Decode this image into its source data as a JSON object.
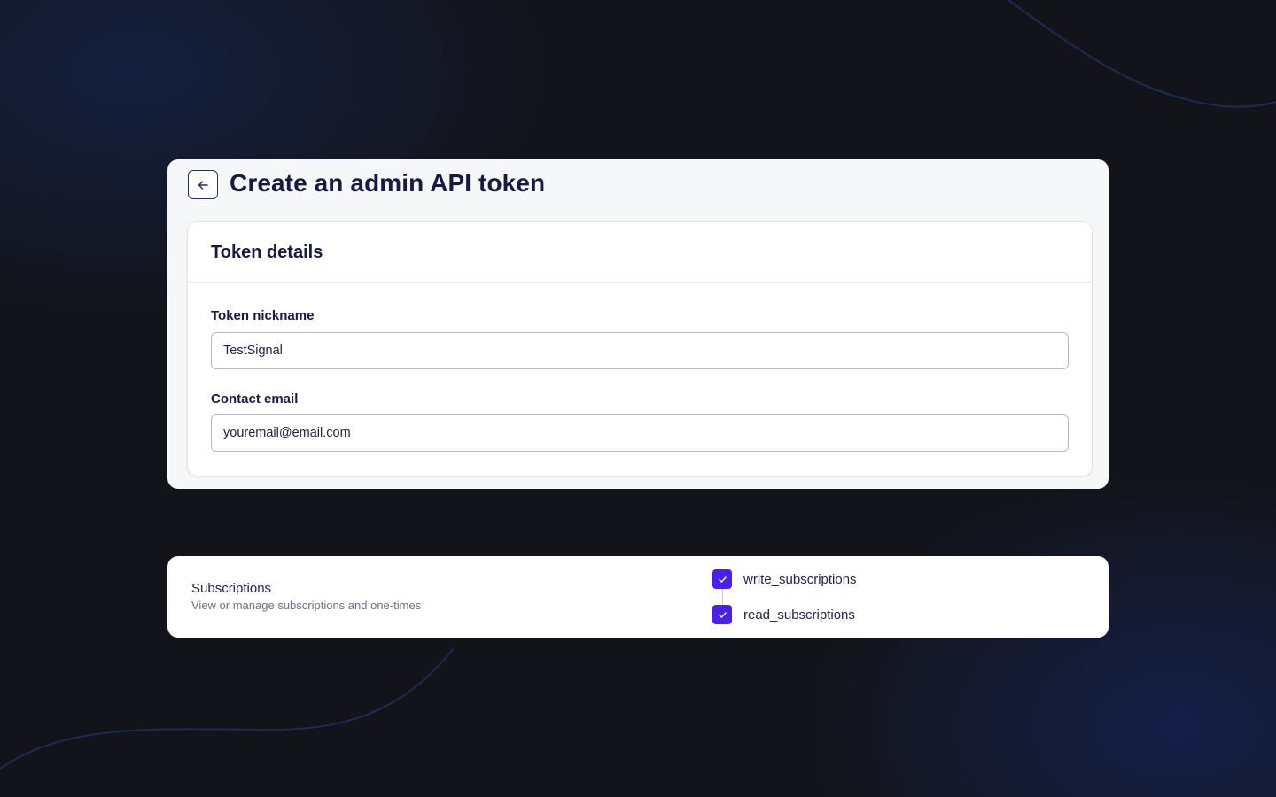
{
  "header": {
    "back_label": "Back",
    "title": "Create an admin API token"
  },
  "token_details": {
    "title": "Token details",
    "nickname_label": "Token nickname",
    "nickname_value": "TestSignal",
    "email_label": "Contact email",
    "email_value": "youremail@email.com"
  },
  "subscriptions": {
    "title": "Subscriptions",
    "description": "View or manage subscriptions and one-times",
    "permissions": [
      {
        "label": "write_subscriptions",
        "checked": true
      },
      {
        "label": "read_subscriptions",
        "checked": true
      }
    ]
  },
  "icons": {
    "back": "arrow-left-icon",
    "check": "checkmark-icon"
  },
  "colors": {
    "background": "#131419",
    "panel": "#f5f7f9",
    "card": "#ffffff",
    "heading": "#161a44",
    "accent": "#4a20e8",
    "field_border": "#b7bac6"
  }
}
